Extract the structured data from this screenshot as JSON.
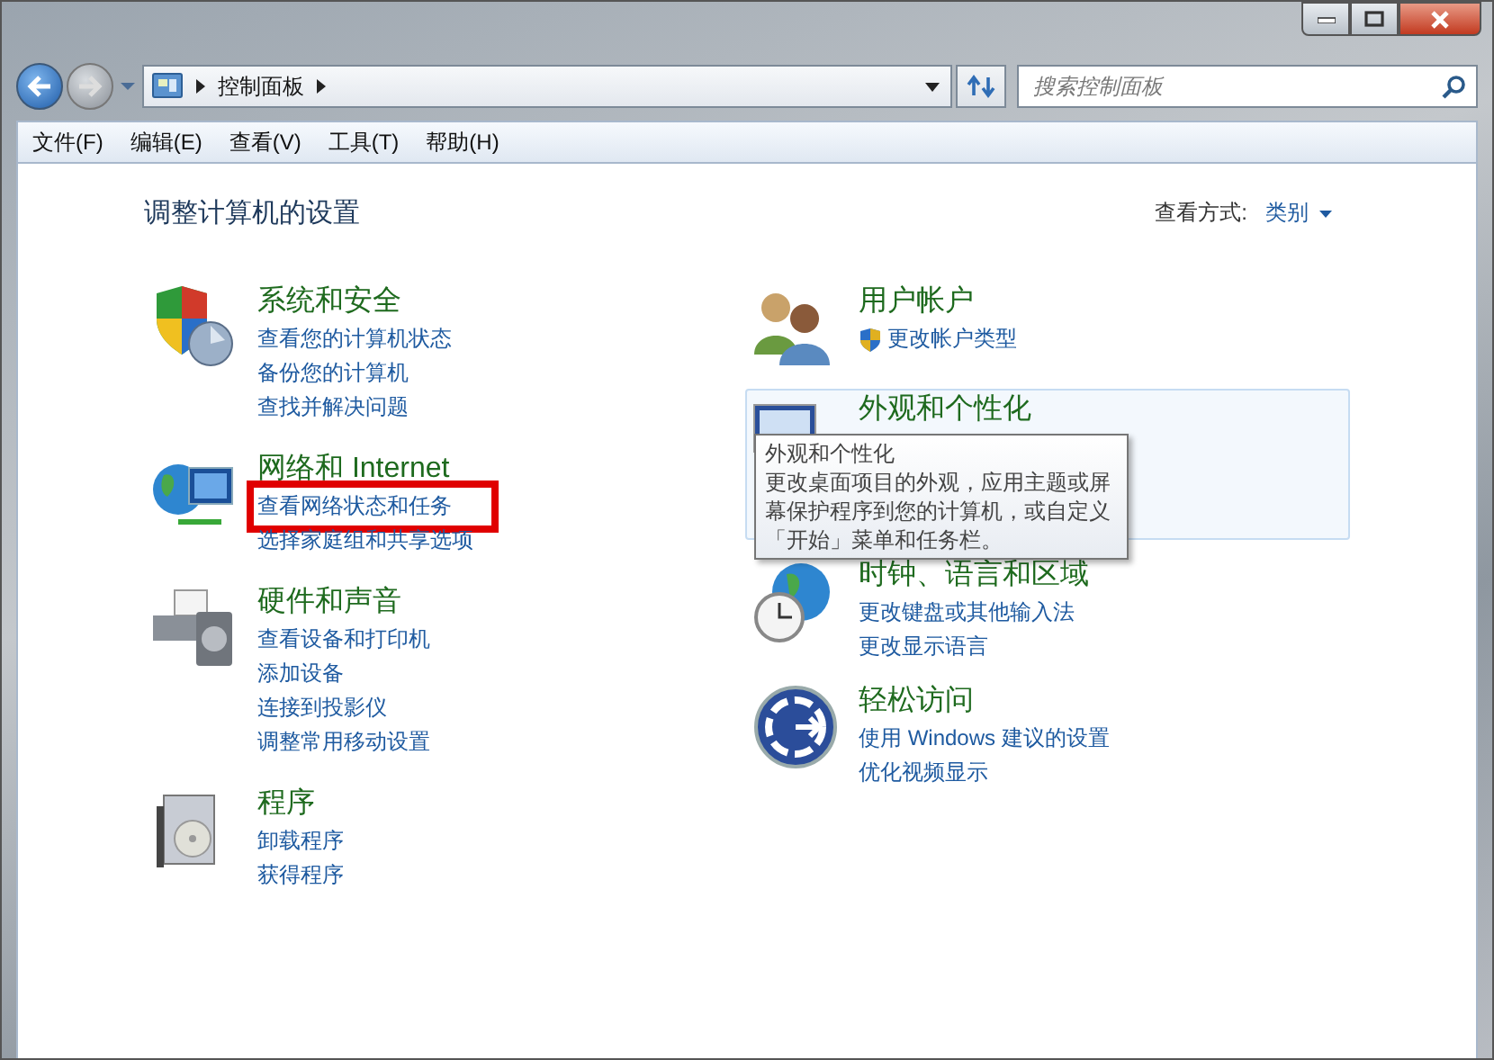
{
  "address_bar": {
    "breadcrumb": [
      "控制面板"
    ]
  },
  "search": {
    "placeholder": "搜索控制面板"
  },
  "menu": [
    "文件(F)",
    "编辑(E)",
    "查看(V)",
    "工具(T)",
    "帮助(H)"
  ],
  "page_title": "调整计算机的设置",
  "view_by": {
    "label": "查看方式:",
    "value": "类别"
  },
  "columns": [
    [
      {
        "kind": "security",
        "title": "系统和安全",
        "hovered": false,
        "links": [
          {
            "text": "查看您的计算机状态",
            "highlighted": false,
            "shield": false
          },
          {
            "text": "备份您的计算机",
            "highlighted": false,
            "shield": false
          },
          {
            "text": "查找并解决问题",
            "highlighted": false,
            "shield": false
          }
        ]
      },
      {
        "kind": "network",
        "title": "网络和 Internet",
        "hovered": false,
        "links": [
          {
            "text": "查看网络状态和任务",
            "highlighted": true,
            "shield": false
          },
          {
            "text": "选择家庭组和共享选项",
            "highlighted": false,
            "shield": false
          }
        ]
      },
      {
        "kind": "hardware",
        "title": "硬件和声音",
        "hovered": false,
        "links": [
          {
            "text": "查看设备和打印机",
            "highlighted": false,
            "shield": false
          },
          {
            "text": "添加设备",
            "highlighted": false,
            "shield": false
          },
          {
            "text": "连接到投影仪",
            "highlighted": false,
            "shield": false
          },
          {
            "text": "调整常用移动设置",
            "highlighted": false,
            "shield": false
          }
        ]
      },
      {
        "kind": "programs",
        "title": "程序",
        "hovered": false,
        "links": [
          {
            "text": "卸载程序",
            "highlighted": false,
            "shield": false
          },
          {
            "text": "获得程序",
            "highlighted": false,
            "shield": false
          }
        ]
      }
    ],
    [
      {
        "kind": "users",
        "title": "用户帐户",
        "hovered": false,
        "links": [
          {
            "text": "更改帐户类型",
            "highlighted": false,
            "shield": true
          }
        ]
      },
      {
        "kind": "appearance",
        "title": "外观和个性化",
        "hovered": true,
        "tooltip": {
          "title": "外观和个性化",
          "text": "更改桌面项目的外观，应用主题或屏幕保护程序到您的计算机，或自定义「开始」菜单和任务栏。"
        }
      },
      {
        "kind": "clock",
        "title": "时钟、语言和区域",
        "hovered": false,
        "links": [
          {
            "text": "更改键盘或其他输入法",
            "highlighted": false,
            "shield": false
          },
          {
            "text": "更改显示语言",
            "highlighted": false,
            "shield": false
          }
        ]
      },
      {
        "kind": "access",
        "title": "轻松访问",
        "hovered": false,
        "links": [
          {
            "text": "使用 Windows 建议的设置",
            "highlighted": false,
            "shield": false
          },
          {
            "text": "优化视频显示",
            "highlighted": false,
            "shield": false
          }
        ]
      }
    ]
  ]
}
